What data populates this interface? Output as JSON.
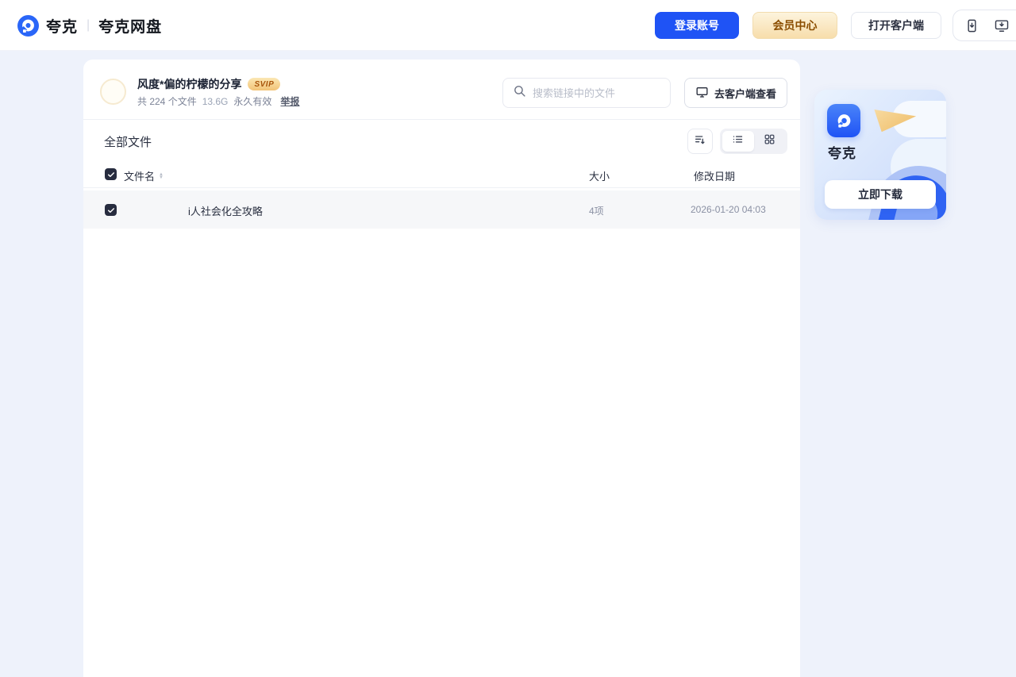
{
  "header": {
    "brand_name": "夸克",
    "brand_product": "夸克网盘",
    "login_label": "登录账号",
    "vip_label": "会员中心",
    "open_client_label": "打开客户端"
  },
  "share": {
    "title": "风度*偏的柠檬的分享",
    "badge": "SVIP",
    "meta_count": "共 224 个文件",
    "meta_size": "13.6G",
    "meta_validity": "永久有效",
    "report_label": "举报",
    "search_placeholder": "搜索链接中的文件",
    "client_view_label": "去客户端查看"
  },
  "files": {
    "section_title": "全部文件",
    "col_name": "文件名",
    "col_size": "大小",
    "col_modified": "修改日期",
    "rows": [
      {
        "name": "i人社会化全攻略",
        "size": "4项",
        "modified": "2026-01-20 04:03",
        "selected": true
      }
    ]
  },
  "promo": {
    "app_name": "夸克",
    "download_label": "立即下载"
  },
  "colors": {
    "accent_blue": "#1f53f5",
    "vip_gold_bg": "#f7ddab",
    "vip_gold_text": "#8a4d00",
    "page_bg": "#eef2fb",
    "selected_row_bg": "#f6f7f9",
    "checkbox_bg": "#272c3f"
  }
}
